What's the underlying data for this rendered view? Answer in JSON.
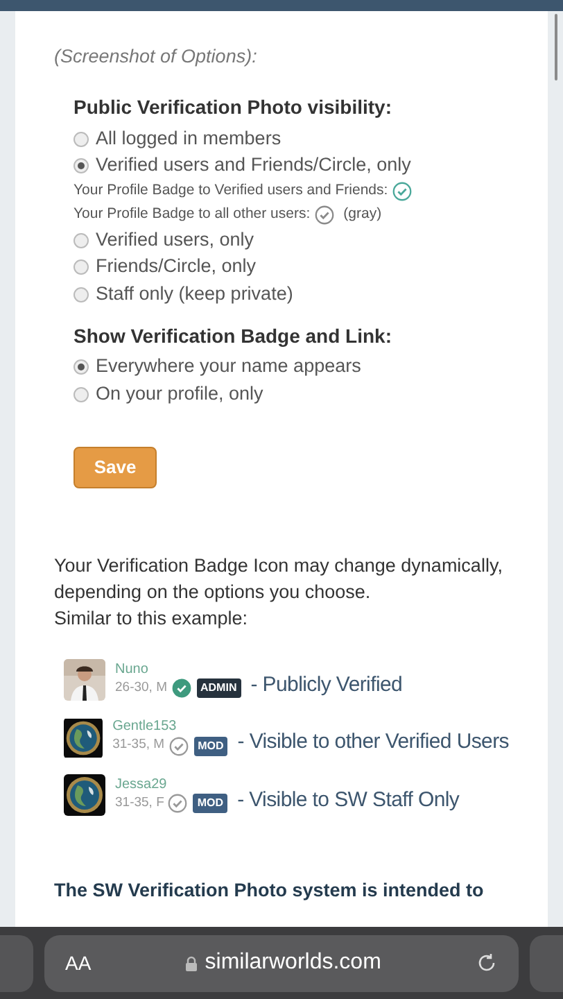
{
  "caption": "(Screenshot of Options):",
  "visibility": {
    "heading": "Public Verification Photo visibility:",
    "options": [
      {
        "kind": "radio",
        "label": "All logged in members",
        "selected": false
      },
      {
        "kind": "radio",
        "label": "Verified users and Friends/Circle, only",
        "selected": true
      },
      {
        "kind": "note",
        "label": "Your Profile Badge to Verified users and Friends:",
        "color": "#4aa89a"
      },
      {
        "kind": "note",
        "label": "Your Profile Badge to all other users:",
        "color": "#8a8a8a",
        "suffix": "(gray)"
      },
      {
        "kind": "radio",
        "label": "Verified users, only",
        "selected": false
      },
      {
        "kind": "radio",
        "label": "Friends/Circle, only",
        "selected": false
      },
      {
        "kind": "radio",
        "label": "Staff only (keep private)",
        "selected": false
      }
    ]
  },
  "badge_setting": {
    "heading": "Show Verification Badge and Link:",
    "options": [
      {
        "kind": "radio",
        "label": "Everywhere your name appears",
        "selected": true
      },
      {
        "kind": "radio",
        "label": "On your profile, only",
        "selected": false
      }
    ]
  },
  "save_button": "Save",
  "description": [
    "Your Verification Badge Icon may change dynamically,",
    "depending on the options you choose.",
    "Similar to this example:"
  ],
  "examples": [
    {
      "name": "Nuno",
      "meta": "26-30, M",
      "badge_filled": true,
      "role": "ADMIN",
      "color": "#26323d",
      "caption": "- Publicly Verified"
    },
    {
      "name": "Gentle153",
      "meta": "31-35, M",
      "badge_filled": false,
      "role": "MOD",
      "color": "#3f5f82",
      "caption": "- Visible to other Verified Users"
    },
    {
      "name": "Jessa29",
      "meta": "31-35, F",
      "badge_filled": false,
      "role": "MOD",
      "color": "#3f5f82",
      "caption": "- Visible to SW Staff Only"
    }
  ],
  "footer_heading": "The SW Verification Photo system is intended to",
  "browser": {
    "text_size": "AA",
    "url": "similarworlds.com"
  }
}
